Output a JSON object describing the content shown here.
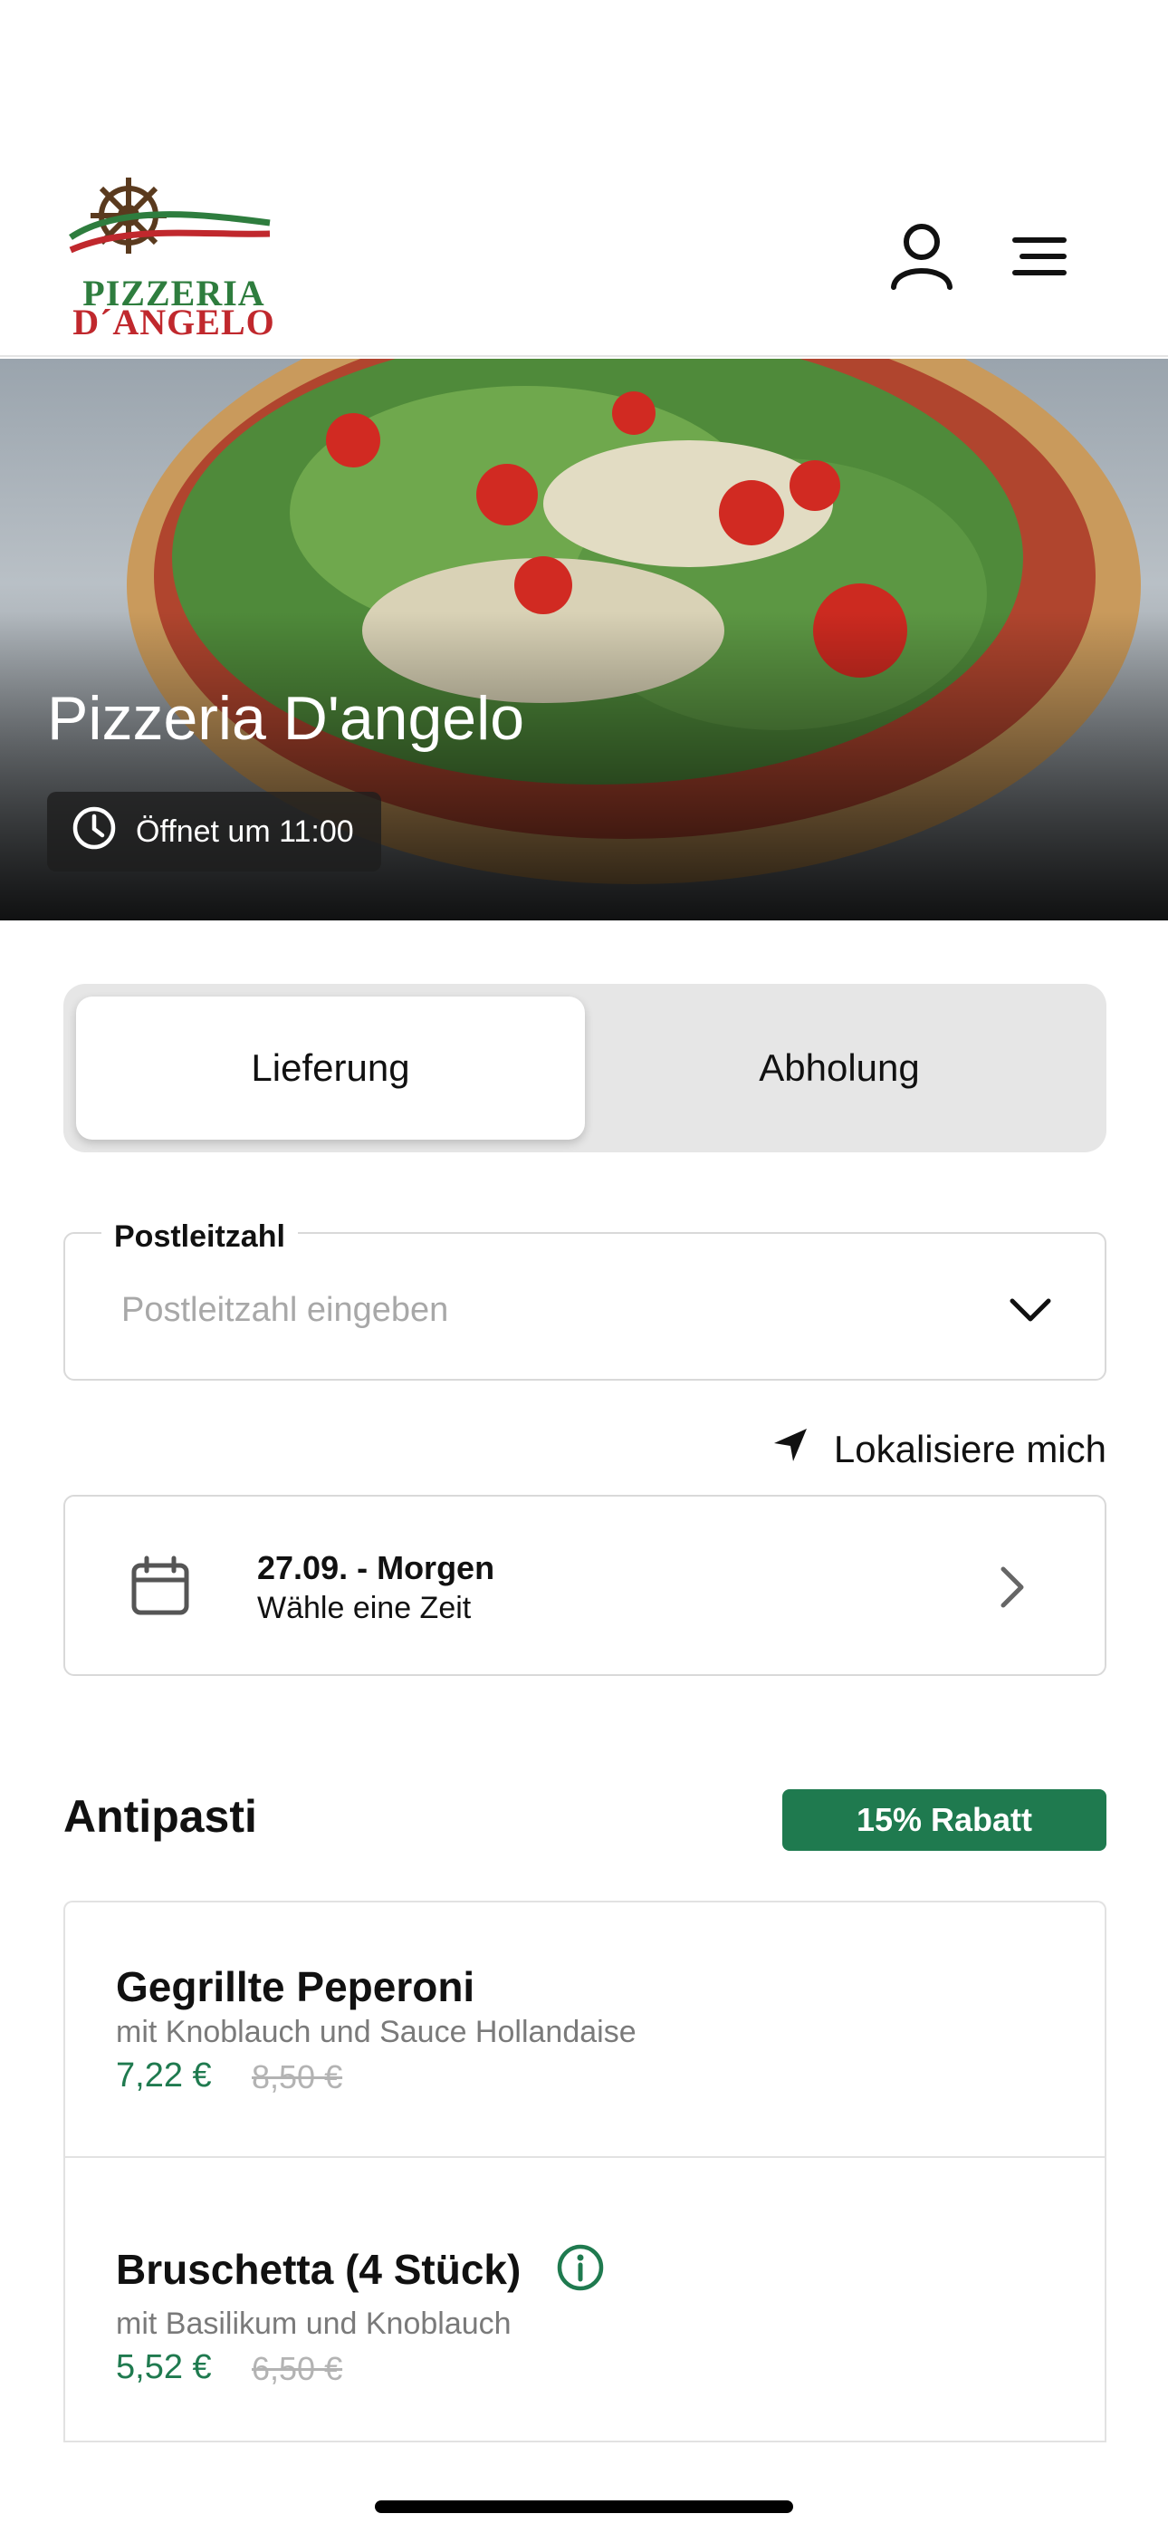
{
  "header": {
    "logo_line1": "PIZZERIA",
    "logo_line2": "D´ANGELO",
    "icons": [
      "user-icon",
      "menu-icon"
    ]
  },
  "hero": {
    "title": "Pizzeria D'angelo",
    "hours": "Öffnet um 11:00",
    "hours_icon": "clock-icon"
  },
  "order_mode": {
    "options": [
      "Lieferung",
      "Abholung"
    ],
    "selected": "Lieferung"
  },
  "postal": {
    "label": "Postleitzahl",
    "placeholder": "Postleitzahl eingeben",
    "value": ""
  },
  "locate": {
    "label": "Lokalisiere mich",
    "icon": "location-arrow-icon"
  },
  "time_select": {
    "date": "27.09. - Morgen",
    "subtitle": "Wähle eine Zeit",
    "icon": "calendar-icon"
  },
  "category": {
    "title": "Antipasti",
    "badge": "15% Rabatt",
    "products": [
      {
        "name": "Gegrillte Peperoni",
        "description": "mit Knoblauch und Sauce Hollandaise",
        "price": "7,22 €",
        "old_price": "8,50 €"
      },
      {
        "name": "Bruschetta (4 Stück)",
        "description": "mit Basilikum und Knoblauch",
        "price": "5,52 €",
        "old_price": "6,50 €",
        "info_icon": "info-icon"
      }
    ]
  },
  "colors": {
    "accent_green": "#1f7a4f",
    "logo_green": "#2e7d3e",
    "logo_red": "#c0282d",
    "segment_bg": "#e6e6e6"
  }
}
